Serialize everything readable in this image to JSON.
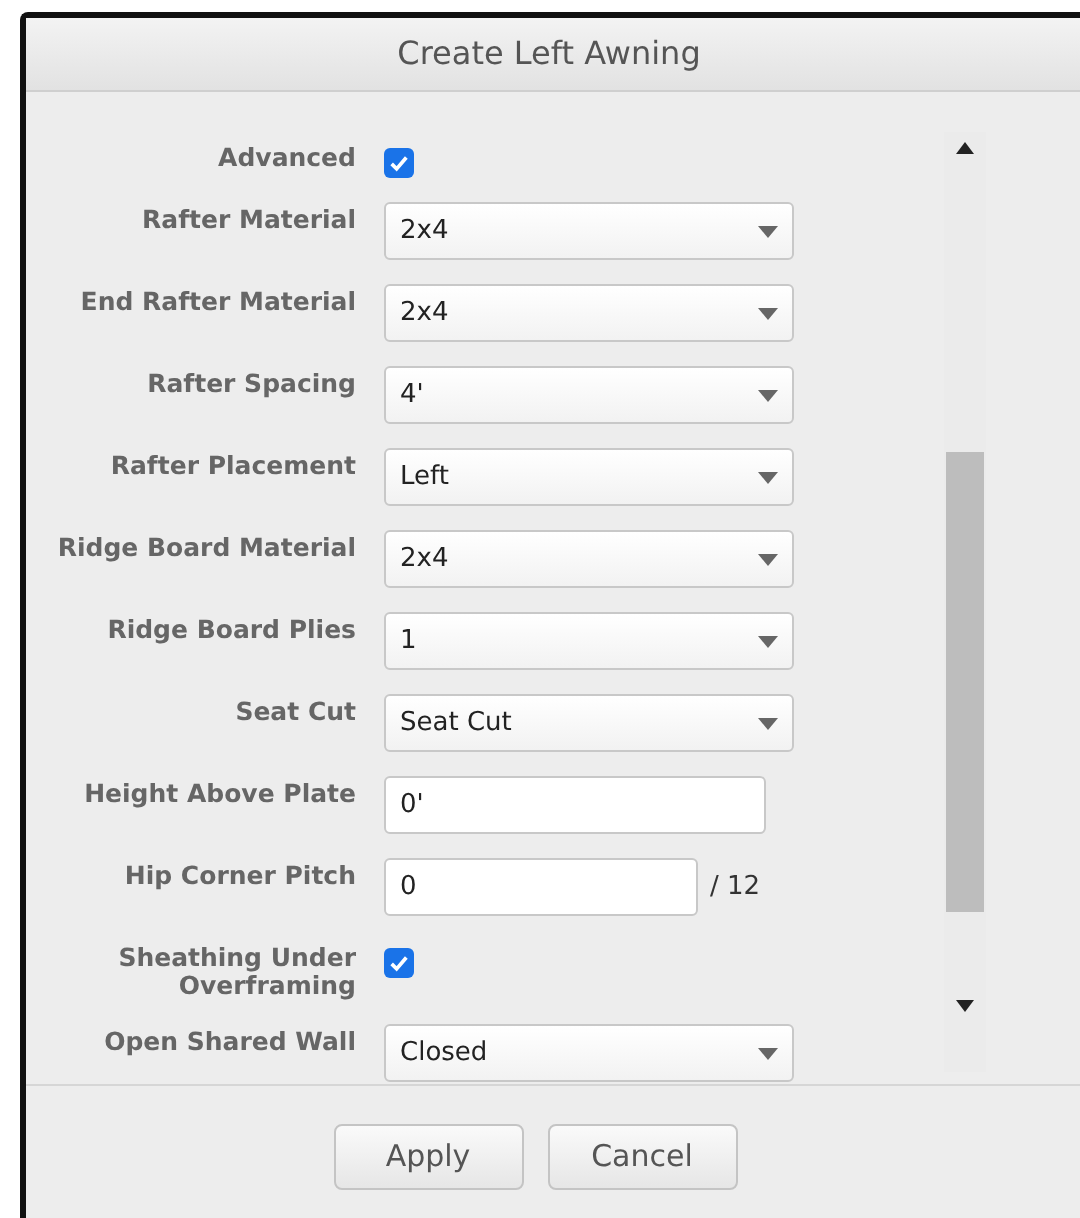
{
  "window": {
    "title": "Create Left Awning"
  },
  "fields": [
    {
      "kind": "checkbox",
      "label": "Advanced",
      "checked": true
    },
    {
      "kind": "select",
      "label": "Rafter Material",
      "value": "2x4"
    },
    {
      "kind": "select",
      "label": "End Rafter Material",
      "value": "2x4"
    },
    {
      "kind": "select",
      "label": "Rafter Spacing",
      "value": "4'"
    },
    {
      "kind": "select",
      "label": "Rafter Placement",
      "value": "Left"
    },
    {
      "kind": "select",
      "label": "Ridge Board Material",
      "value": "2x4"
    },
    {
      "kind": "select",
      "label": "Ridge Board Plies",
      "value": "1"
    },
    {
      "kind": "select",
      "label": "Seat Cut",
      "value": "Seat Cut"
    },
    {
      "kind": "text",
      "label": "Height Above Plate",
      "value": "0'"
    },
    {
      "kind": "text",
      "label": "Hip Corner Pitch",
      "value": "0",
      "suffix": "/ 12"
    },
    {
      "kind": "checkbox",
      "label": "Sheathing Under Overframing",
      "checked": true
    },
    {
      "kind": "select",
      "label": "Open Shared Wall",
      "value": "Closed"
    }
  ],
  "buttons": [
    "Apply",
    "Cancel"
  ]
}
